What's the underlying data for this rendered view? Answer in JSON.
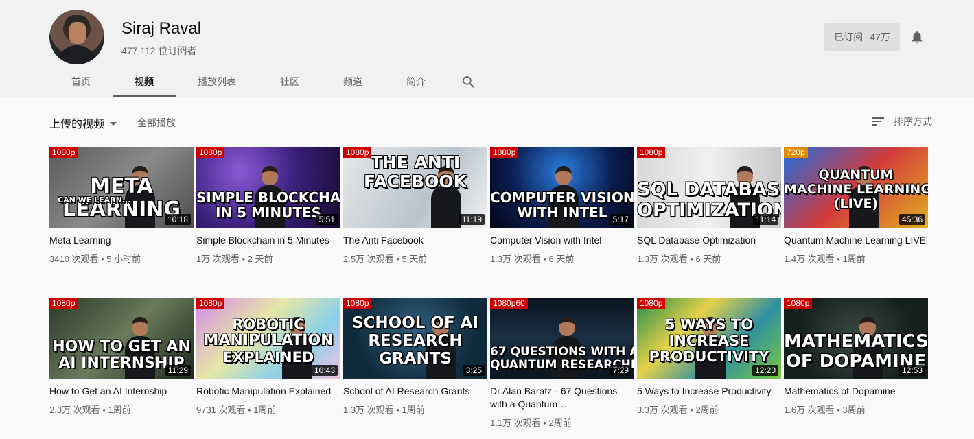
{
  "channel": {
    "name": "Siraj Raval",
    "subscribers": "477,112 位订阅者",
    "subscribe_label": "已订阅",
    "subscribe_count": "47万"
  },
  "tabs": [
    "首页",
    "视频",
    "播放列表",
    "社区",
    "频道",
    "简介"
  ],
  "active_tab": "视频",
  "toolbar": {
    "uploads": "上传的视频",
    "play_all": "全部播放",
    "sort": "排序方式"
  },
  "videos": [
    {
      "title": "Meta Learning",
      "meta": "3410 次观看 • 5 小时前",
      "duration": "10:18",
      "res": "1080p",
      "thumb_text": [
        "META",
        "LEARNING"
      ],
      "thumb_small": "CAN WE LEARN..."
    },
    {
      "title": "Simple Blockchain in 5 Minutes",
      "meta": "1万 次观看 • 2 天前",
      "duration": "5:51",
      "res": "1080p",
      "thumb_text": [
        "SIMPLE BLOCKCHAIN",
        "IN 5 MINUTES"
      ]
    },
    {
      "title": "The Anti Facebook",
      "meta": "2.5万 次观看 • 5 天前",
      "duration": "11:19",
      "res": "1080p",
      "thumb_text": [
        "THE ANTI",
        "FACEBOOK"
      ]
    },
    {
      "title": "Computer Vision with Intel",
      "meta": "1.3万 次观看 • 6 天前",
      "duration": "5:17",
      "res": "1080p",
      "thumb_text": [
        "COMPUTER VISION",
        "WITH INTEL"
      ]
    },
    {
      "title": "SQL Database Optimization",
      "meta": "1.3万 次观看 • 6 天前",
      "duration": "11:14",
      "res": "1080p",
      "thumb_text": [
        "SQL DATABASE",
        "OPTIMIZATION"
      ]
    },
    {
      "title": "Quantum Machine Learning LIVE",
      "meta": "1.4万 次观看 • 1周前",
      "duration": "45:36",
      "res": "720p",
      "thumb_text": [
        "QUANTUM",
        "MACHINE LEARNING",
        "(LIVE)"
      ]
    },
    {
      "title": "How to Get an AI Internship",
      "meta": "2.3万 次观看 • 1周前",
      "duration": "11:29",
      "res": "1080p",
      "thumb_text": [
        "HOW TO GET AN",
        "AI INTERNSHIP"
      ]
    },
    {
      "title": "Robotic Manipulation Explained",
      "meta": "9731 次观看 • 1周前",
      "duration": "10:43",
      "res": "1080p",
      "thumb_text": [
        "ROBOTIC",
        "MANIPULATION",
        "EXPLAINED"
      ]
    },
    {
      "title": "School of AI Research Grants",
      "meta": "1.3万 次观看 • 1周前",
      "duration": "3:25",
      "res": "1080p",
      "thumb_text": [
        "SCHOOL OF AI",
        "RESEARCH",
        "GRANTS"
      ]
    },
    {
      "title": "Dr Alan Baratz - 67 Questions with a Quantum…",
      "meta": "1.1万 次观看 • 2周前",
      "duration": "7:29",
      "res": "1080p60",
      "thumb_text": [
        "67 QUESTIONS WITH A",
        "QUANTUM RESEARCHER"
      ]
    },
    {
      "title": "5 Ways to Increase Productivity",
      "meta": "3.3万 次观看 • 2周前",
      "duration": "12:20",
      "res": "1080p",
      "thumb_text": [
        "5 WAYS TO",
        "INCREASE",
        "PRODUCTIVITY"
      ]
    },
    {
      "title": "Mathematics of Dopamine",
      "meta": "1.6万 次观看 • 3周前",
      "duration": "12:53",
      "res": "1080p",
      "thumb_text": [
        "MATHEMATICS",
        "OF DOPAMINE"
      ]
    }
  ],
  "colors": {
    "header_bg": "#f1f1f1",
    "page_bg": "#f9f9f9",
    "badge_red": "#cc0000",
    "badge_orange": "#e08a00"
  }
}
